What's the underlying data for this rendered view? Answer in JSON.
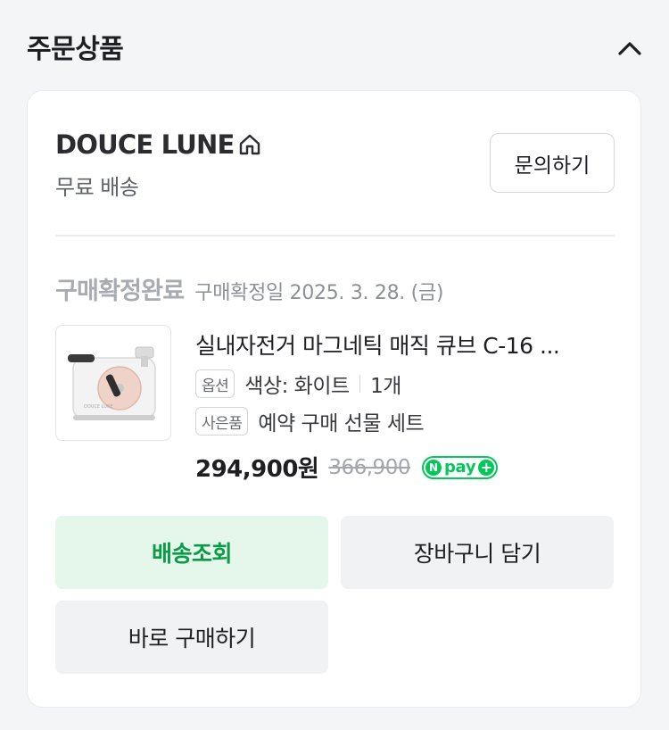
{
  "section": {
    "title": "주문상품"
  },
  "seller": {
    "name": "DOUCE LUNE",
    "shipping": "무료 배송",
    "inquiry_label": "문의하기"
  },
  "order": {
    "status": "구매확정완료",
    "status_date": "구매확정일 2025. 3. 28. (금)"
  },
  "product": {
    "name": "실내자전거 마그네틱 매직 큐브 C-16 ...",
    "option_tag": "옵션",
    "option_value": "색상: 화이트",
    "quantity": "1개",
    "gift_tag": "사은품",
    "gift_value": "예약 구매 선물 세트",
    "price": "294,900원",
    "original_price": "366,900",
    "npay_n": "N",
    "npay_text": "pay",
    "npay_plus": "+"
  },
  "actions": {
    "track_label": "배송조회",
    "cart_label": "장바구니 담기",
    "buy_label": "바로 구매하기"
  },
  "colors": {
    "accent_green": "#03c75a",
    "track_text": "#0a9b48",
    "track_bg": "#e4f7ea"
  }
}
